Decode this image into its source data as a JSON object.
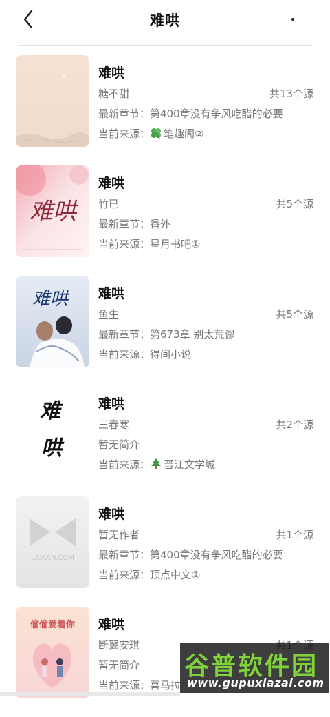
{
  "header": {
    "title": "难哄"
  },
  "books": [
    {
      "title": "难哄",
      "author": "糖不甜",
      "count": "共13个源",
      "detail": "最新章节：第400章没有争风吃醋的必要",
      "source_prefix": "当前来源：",
      "source_icon": "clover-icon",
      "source_name": "笔趣阁②"
    },
    {
      "title": "难哄",
      "author": "竹已",
      "count": "共5个源",
      "detail": "最新章节：番外",
      "source_prefix": "当前来源：",
      "source_icon": "",
      "source_name": "星月书吧①",
      "cover_text": "难哄"
    },
    {
      "title": "难哄",
      "author": "鱼生",
      "count": "共5个源",
      "detail": "最新章节：第673章 别太荒谬",
      "source_prefix": "当前来源：",
      "source_icon": "",
      "source_name": "得间小说",
      "cover_text": "难哄"
    },
    {
      "title": "难哄",
      "author": "三春寒",
      "count": "共2个源",
      "detail": "暂无简介",
      "source_prefix": "当前来源：",
      "source_icon": "tree-icon",
      "source_name": "晋江文学城",
      "cover_text_top": "难",
      "cover_text_bottom": "哄"
    },
    {
      "title": "难哄",
      "author": "暂无作者",
      "count": "共1个源",
      "detail": "最新章节：第400章没有争风吃醋的必要",
      "source_prefix": "当前来源：",
      "source_icon": "",
      "source_name": "顶点中文②",
      "cover_text": "LAIKAN.COM"
    },
    {
      "title": "难哄",
      "author": "断翼安琪",
      "count": "共1个源",
      "detail": "暂无简介",
      "source_prefix": "当前来源：",
      "source_icon": "",
      "source_name": "喜马拉",
      "cover_text": "偷偷爱着你"
    }
  ],
  "watermark": {
    "main": "谷普软件园",
    "url": "www.gupuxiazai.com"
  }
}
